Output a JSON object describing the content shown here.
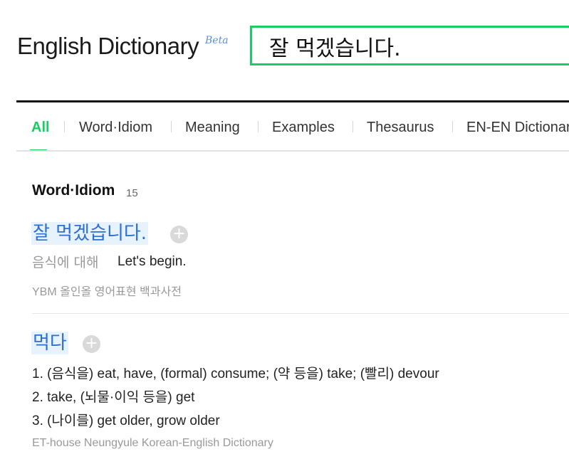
{
  "header": {
    "logo_text": "English Dictionary",
    "beta_label": "Beta",
    "search_value": "잘 먹겠습니다."
  },
  "tabs": [
    {
      "label": "All",
      "active": true
    },
    {
      "label": "Word·Idiom"
    },
    {
      "label": "Meaning"
    },
    {
      "label": "Examples"
    },
    {
      "label": "Thesaurus"
    },
    {
      "label": "EN-EN Dictionary"
    }
  ],
  "section": {
    "title": "Word·Idiom",
    "count": "15"
  },
  "entries": [
    {
      "word": "잘 먹겠습니다.",
      "context": "음식에 대해",
      "meaning": "Let's begin.",
      "source": "YBM 올인올 영어표현 백과사전"
    },
    {
      "word": "먹다",
      "meanings": [
        "1. (음식을) eat, have, (formal) consume; (약 등을) take; (빨리) devour",
        "2. take, (뇌물·이익 등을) get",
        "3. (나이를) get older, grow older"
      ],
      "source": "ET-house Neungyule Korean-English Dictionary"
    }
  ],
  "colors": {
    "accent": "#19ce60",
    "link": "#2e6ed3",
    "highlight": "#e6f2fc"
  },
  "icons": {
    "add": "plus-circle-icon"
  }
}
